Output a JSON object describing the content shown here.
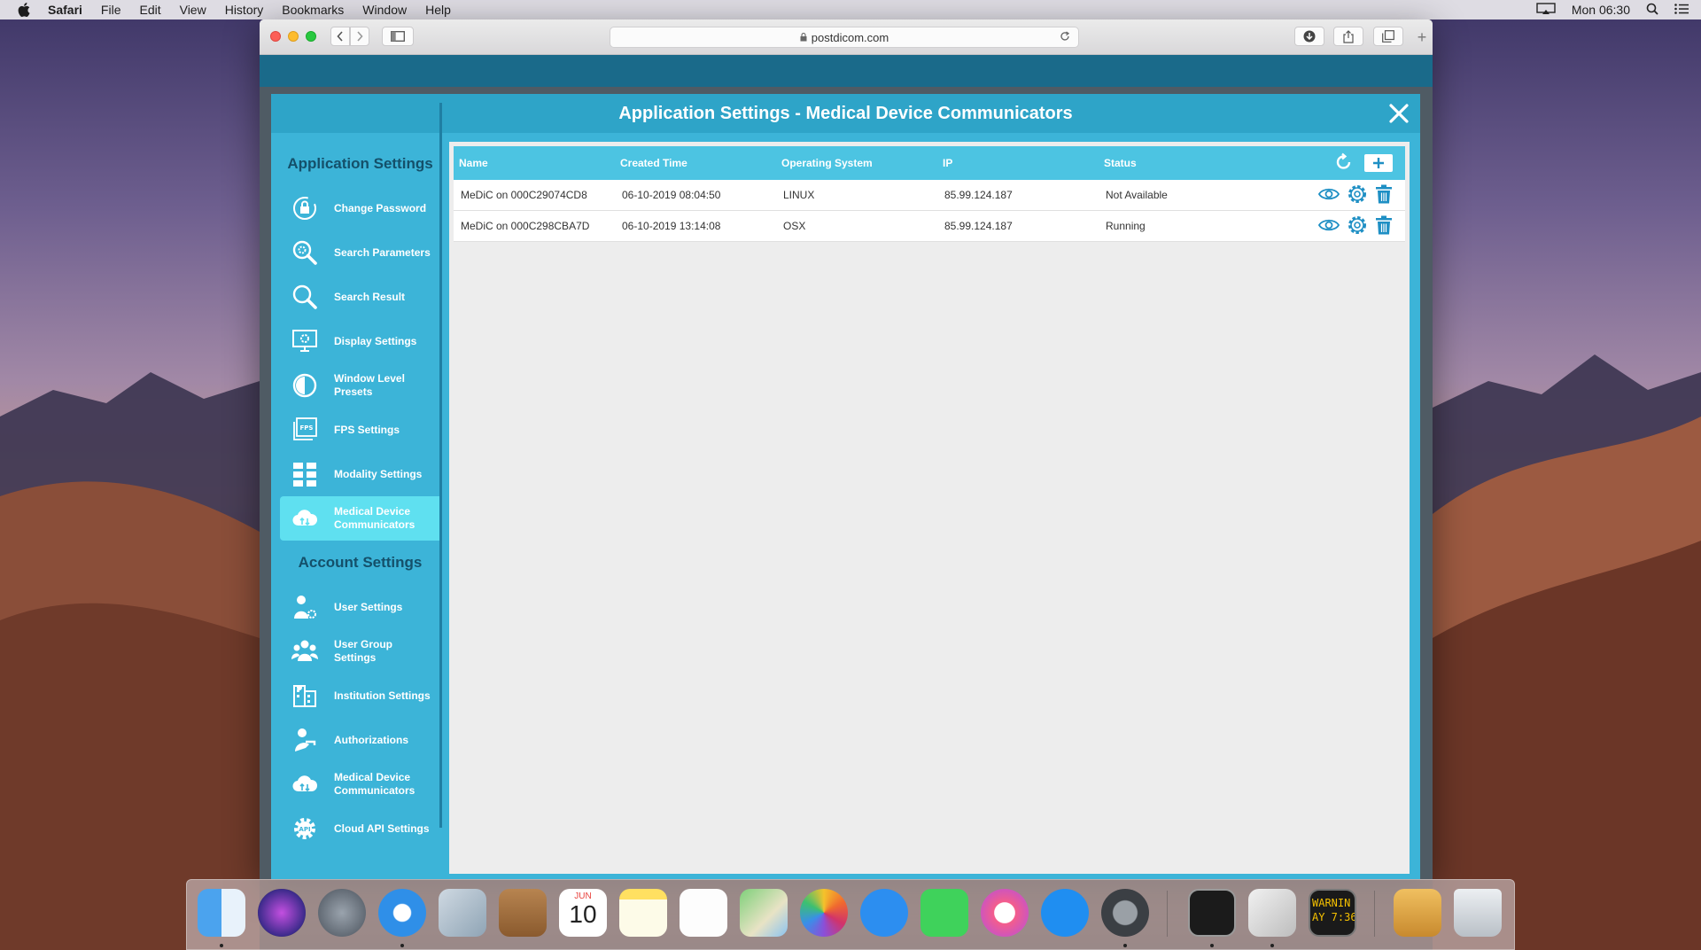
{
  "menubar": {
    "items": [
      "Safari",
      "File",
      "Edit",
      "View",
      "History",
      "Bookmarks",
      "Window",
      "Help"
    ],
    "clock": "Mon 06:30"
  },
  "browser": {
    "url": "postdicom.com"
  },
  "modal": {
    "title": "Application Settings - Medical Device Communicators"
  },
  "sidebar": {
    "app_section": "Application Settings",
    "app_items": [
      {
        "label": "Change Password",
        "icon": "lock-icon"
      },
      {
        "label": "Search Parameters",
        "icon": "search-gear-icon"
      },
      {
        "label": "Search Result",
        "icon": "search-icon"
      },
      {
        "label": "Display Settings",
        "icon": "monitor-gear-icon"
      },
      {
        "label": "Window Level Presets",
        "icon": "contrast-icon"
      },
      {
        "label": "FPS Settings",
        "icon": "fps-icon"
      },
      {
        "label": "Modality Settings",
        "icon": "grid-icon"
      },
      {
        "label": "Medical Device Communicators",
        "icon": "cloud-icon"
      }
    ],
    "account_section": "Account Settings",
    "account_items": [
      {
        "label": "User Settings",
        "icon": "user-gear-icon"
      },
      {
        "label": "User Group Settings",
        "icon": "users-icon"
      },
      {
        "label": "Institution Settings",
        "icon": "building-icon"
      },
      {
        "label": "Authorizations",
        "icon": "key-user-icon"
      },
      {
        "label": "Medical Device Communicators",
        "icon": "cloud-icon"
      },
      {
        "label": "Cloud API Settings",
        "icon": "api-gear-icon"
      }
    ]
  },
  "table": {
    "headers": {
      "name": "Name",
      "created": "Created Time",
      "os": "Operating System",
      "ip": "IP",
      "status": "Status"
    },
    "rows": [
      {
        "name": "MeDiC on 000C29074CD8",
        "created": "06-10-2019 08:04:50",
        "os": "LINUX",
        "ip": "85.99.124.187",
        "status": "Not Available"
      },
      {
        "name": "MeDiC on 000C298CBA7D",
        "created": "06-10-2019 13:14:08",
        "os": "OSX",
        "ip": "85.99.124.187",
        "status": "Running"
      }
    ]
  },
  "dock": {
    "calendar_month": "JUN",
    "calendar_day": "10",
    "console_text": "WARNIN\nAY 7:36"
  },
  "colors": {
    "modal": "#3cb4d8",
    "modal_title": "#2ea4c8",
    "table_header": "#4cc4e2",
    "active_item": "#5fe0f0",
    "icon_blue": "#1e8fc4"
  }
}
